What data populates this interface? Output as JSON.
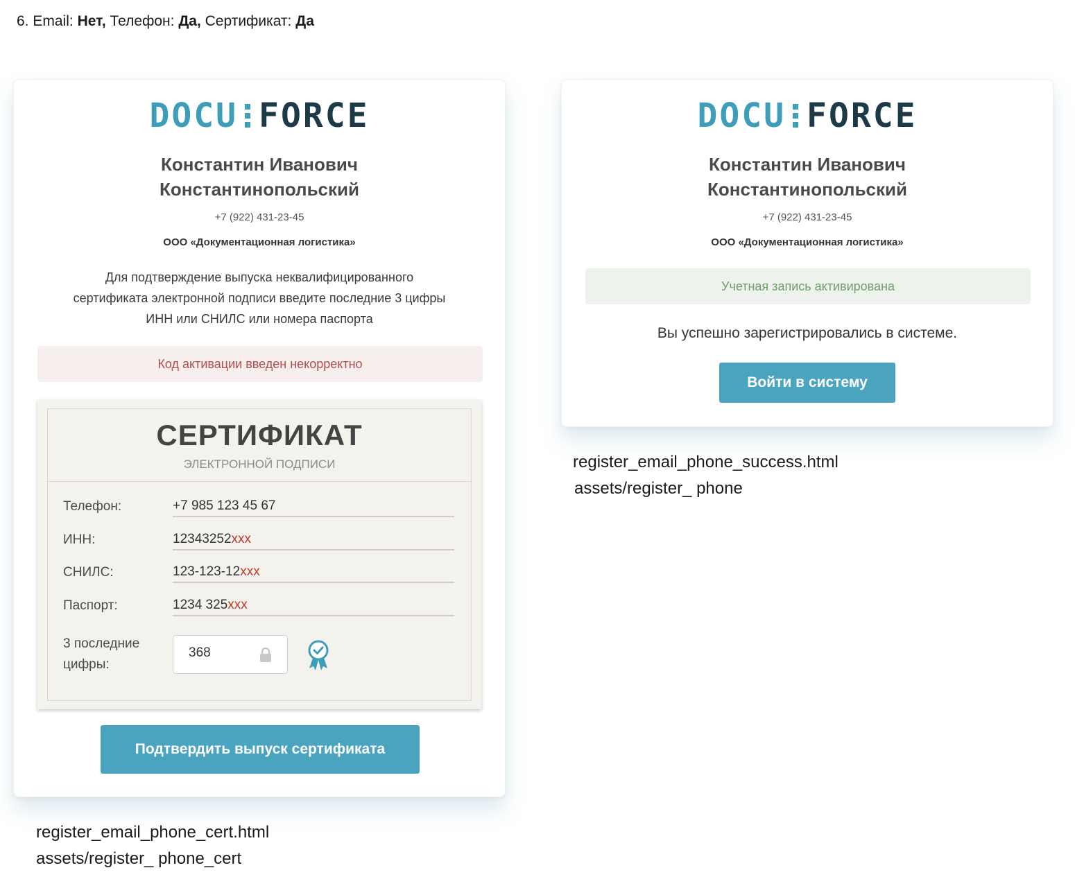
{
  "heading": {
    "number": "6.",
    "email_label": "Email:",
    "email_value": "Нет,",
    "phone_label": "Телефон:",
    "phone_value": "Да,",
    "cert_label": "Сертификат:",
    "cert_value": "Да"
  },
  "brand": {
    "logo_part1": "DOCU",
    "logo_part2": "FORCE",
    "accent_color": "#3e9eba",
    "dark_color": "#1d3a49",
    "button_color": "#4aa3bf"
  },
  "left_card": {
    "name_line1": "Константин Иванович",
    "name_line2": "Константинопольский",
    "phone": "+7 (922) 431-23-45",
    "organization": "ООО «Документационная логистика»",
    "instruction_line1": "Для подтверждение выпуска неквалифицированного",
    "instruction_line2": "сертификата электронной подписи введите последние 3 цифры",
    "instruction_line3": "ИНН или СНИЛС или номера паспорта",
    "error_message": "Код активации введен некорректно",
    "error_color": "#b44c4c",
    "certificate": {
      "title": "СЕРТИФИКАТ",
      "subtitle": "ЭЛЕКТРОННОЙ ПОДПИСИ",
      "rows": [
        {
          "label": "Телефон:",
          "value": "+7 985 123 45 67",
          "masked": ""
        },
        {
          "label": "ИНН:",
          "value": "12343252",
          "masked": "xxx"
        },
        {
          "label": "СНИЛС:",
          "value": "123-123-12",
          "masked": "xxx"
        },
        {
          "label": "Паспорт:",
          "value": "1234 325",
          "masked": "xxx"
        }
      ],
      "last_digits_label_line1": "3 последние",
      "last_digits_label_line2": "цифры:",
      "last_digits_value": "368",
      "lock_icon": "lock-icon",
      "badge_icon": "award-ribbon-check-icon"
    },
    "confirm_button": "Подтвердить выпуск сертификата",
    "filename": "register_email_phone_cert.html",
    "assets_path": "assets/register_ phone_cert"
  },
  "right_card": {
    "name_line1": "Константин Иванович",
    "name_line2": "Константинопольский",
    "phone": "+7 (922) 431-23-45",
    "organization": "ООО «Документационная логистика»",
    "success_alert": "Учетная запись активирована",
    "success_color": "#6f9e6b",
    "success_message": "Вы успешно зарегистрировались в системе.",
    "login_button": "Войти в систему",
    "filename": "register_email_phone_success.html",
    "assets_path": "assets/register_ phone"
  }
}
